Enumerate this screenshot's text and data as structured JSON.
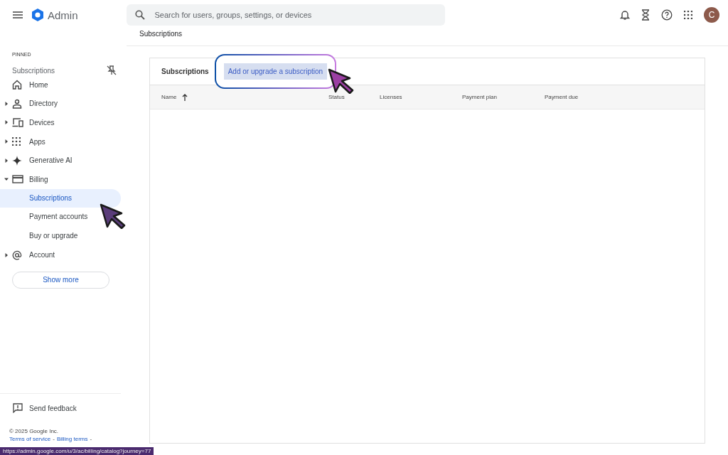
{
  "app": {
    "title": "Admin"
  },
  "search": {
    "placeholder": "Search for users, groups, settings, or devices"
  },
  "avatar": {
    "letter": "C"
  },
  "breadcrumb": "Subscriptions",
  "sidebar": {
    "pinned_heading": "PINNED",
    "pinned": [
      {
        "label": "Subscriptions"
      }
    ],
    "items": [
      {
        "kind": "home",
        "label": "Home"
      },
      {
        "kind": "person",
        "label": "Directory",
        "expanded": false
      },
      {
        "kind": "devices",
        "label": "Devices",
        "expanded": false
      },
      {
        "kind": "apps",
        "label": "Apps",
        "expanded": false
      },
      {
        "kind": "spark",
        "label": "Generative AI",
        "expanded": false
      },
      {
        "kind": "card",
        "label": "Billing",
        "expanded": true,
        "children": [
          {
            "label": "Subscriptions",
            "selected": true
          },
          {
            "label": "Payment accounts",
            "selected": false
          },
          {
            "label": "Buy or upgrade",
            "selected": false
          }
        ]
      },
      {
        "kind": "at",
        "label": "Account",
        "expanded": false
      }
    ],
    "show_more": "Show more",
    "feedback": "Send feedback",
    "copyright": "© 2025 Google Inc.",
    "links": [
      "Terms of service",
      "Billing terms"
    ],
    "link_separator": "-"
  },
  "card": {
    "title": "Subscriptions",
    "action": "Add or upgrade a subscription",
    "columns": [
      {
        "label": "Name",
        "sorted": true
      },
      {
        "label": "Status",
        "sorted": false
      },
      {
        "label": "Licenses",
        "sorted": false
      },
      {
        "label": "Payment plan",
        "sorted": false
      },
      {
        "label": "Payment due",
        "sorted": false
      }
    ]
  },
  "status_url": "https://admin.google.com/u/3/ac/billing/catalog?journey=77"
}
